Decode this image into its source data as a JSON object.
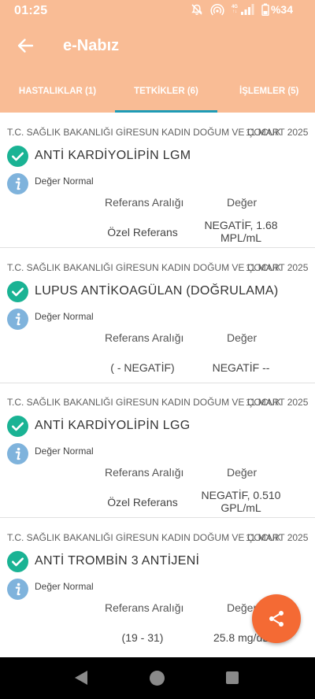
{
  "status_bar": {
    "time": "01:25",
    "network_type_top": "4G",
    "network_type_bottom": "↑↓",
    "battery": "%34",
    "icons": [
      "mute-icon",
      "hotspot-icon",
      "signal-icon",
      "battery-icon"
    ]
  },
  "app_bar": {
    "title": "e-Nabız",
    "back_icon": "arrow-left-icon"
  },
  "tabs": [
    {
      "label": "HASTALIKLAR (1)",
      "active": false
    },
    {
      "label": "TETKİKLER (6)",
      "active": true
    },
    {
      "label": "İŞLEMLER (5)",
      "active": false
    }
  ],
  "tests": [
    {
      "hospital": "T.C. SAĞLIK BAKANLIĞI GİRESUN KADIN DOĞUM VE ÇOCUK",
      "date": "11 MART 2025",
      "name": "ANTİ KARDİYOLİPİN LGM",
      "status": "Değer Normal",
      "reference_label": "Referans Aralığı",
      "value_label": "Değer",
      "reference": "Özel Referans",
      "value_line1": "NEGATİF,  1.68",
      "value_line2": "MPL/mL"
    },
    {
      "hospital": "T.C. SAĞLIK BAKANLIĞI GİRESUN KADIN DOĞUM VE ÇOCUK",
      "date": "11 MART 2025",
      "name": "LUPUS ANTİKOAGÜLAN (DOĞRULAMA)",
      "status": "Değer Normal",
      "reference_label": "Referans Aralığı",
      "value_label": "Değer",
      "reference": "( - NEGATİF)",
      "value_line1": "NEGATİF --",
      "value_line2": ""
    },
    {
      "hospital": "T.C. SAĞLIK BAKANLIĞI GİRESUN KADIN DOĞUM VE ÇOCUK",
      "date": "11 MART 2025",
      "name": "ANTİ KARDİYOLİPİN LGG",
      "status": "Değer Normal",
      "reference_label": "Referans Aralığı",
      "value_label": "Değer",
      "reference": "Özel Referans",
      "value_line1": "NEGATİF,  0.510",
      "value_line2": "GPL/mL"
    },
    {
      "hospital": "T.C. SAĞLIK BAKANLIĞI GİRESUN KADIN DOĞUM VE ÇOCUK",
      "date": "11 MART 2025",
      "name": "ANTİ TROMBİN 3 ANTİJENİ",
      "status": "Değer Normal",
      "reference_label": "Referans Aralığı",
      "value_label": "Değer",
      "reference": "(19  -  31)",
      "value_line1": "25.8 mg/dL",
      "value_line2": ""
    }
  ],
  "colors": {
    "header": "#f9bc95",
    "tab_indicator": "#1e9bb6",
    "check": "#1ab394",
    "info": "#7fb3dc",
    "fab": "#f46a34"
  },
  "fab": {
    "icon": "share-icon"
  },
  "nav_bar": {
    "icons": [
      "nav-back-icon",
      "nav-home-icon",
      "nav-recent-icon"
    ]
  }
}
